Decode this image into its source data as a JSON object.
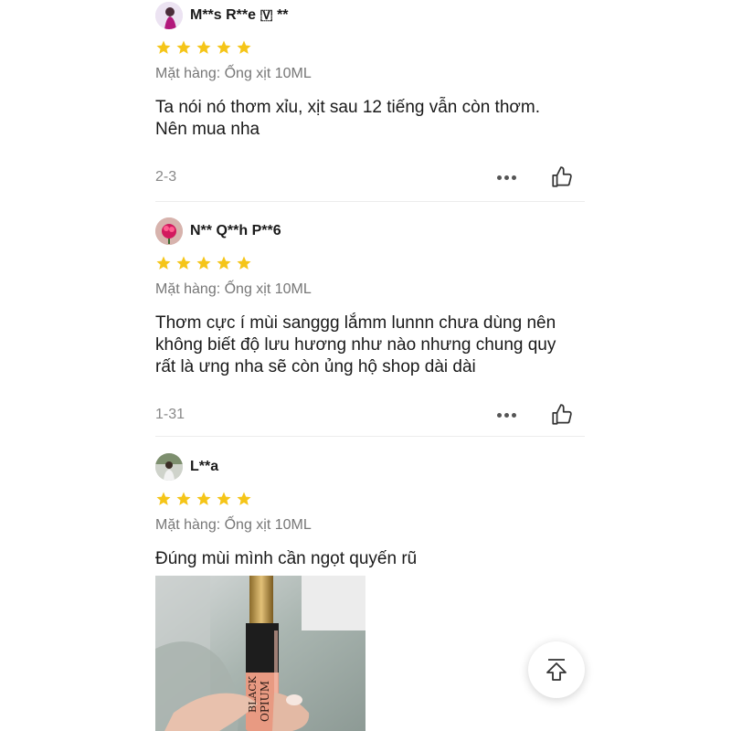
{
  "reviews": [
    {
      "username": "M**s R**e 🇻 **",
      "rating": 5,
      "variant": "Mặt hàng: Ống xịt 10ML",
      "comment_lines": [
        "Ta nói nó thơm xỉu, xịt sau 12 tiếng vẫn còn thơm.",
        "Nên mua nha"
      ],
      "date": "2-3"
    },
    {
      "username": "N** Q**h P**6",
      "rating": 5,
      "variant": "Mặt hàng: Ống xịt 10ML",
      "comment_lines": [
        "Thơm cực í mùi sanggg lắmm lunnn chưa dùng nên",
        "không biết độ lưu hương như nào nhưng chung quy",
        "rất là ưng nha sẽ còn ủng hộ shop dài dài"
      ],
      "date": "1-31"
    },
    {
      "username": "L**a",
      "rating": 5,
      "variant": "Mặt hàng: Ống xịt 10ML",
      "comment_lines": [
        "Đúng mùi mình cần ngọt quyến rũ"
      ],
      "photo_text": [
        "BLACK",
        "OPIUM"
      ]
    }
  ],
  "colors": {
    "star": "#f5c518",
    "text": "#1a1a1a",
    "muted": "#777777"
  },
  "icons": {
    "more": "more-dots-icon",
    "like": "thumbs-up-icon",
    "scroll_top": "scroll-to-top-icon"
  }
}
